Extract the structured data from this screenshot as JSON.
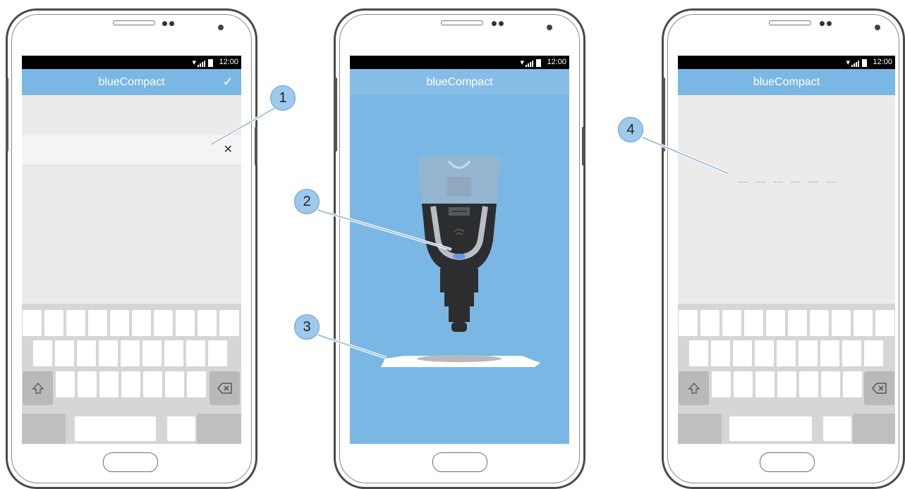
{
  "app": {
    "title": "blueCompact",
    "status_time": "12:00"
  },
  "screens": [
    {
      "id": "input-screen",
      "has_confirm": true,
      "confirm_icon": "check-icon",
      "clear_icon": "close-icon"
    },
    {
      "id": "device-screen",
      "background": "#7ab7e4"
    },
    {
      "id": "pin-screen",
      "pin_length": 6
    }
  ],
  "callouts": [
    {
      "number": "1",
      "target": "text-input-row"
    },
    {
      "number": "2",
      "target": "device-button"
    },
    {
      "number": "3",
      "target": "sample-plate"
    },
    {
      "number": "4",
      "target": "pin-entry-field"
    }
  ],
  "colors": {
    "accent": "#7ab7e4",
    "callout_fill": "#9cc9ec",
    "device_dark": "#2c2d2f",
    "device_light": "#9b9fa6",
    "led": "#5f9be0"
  }
}
